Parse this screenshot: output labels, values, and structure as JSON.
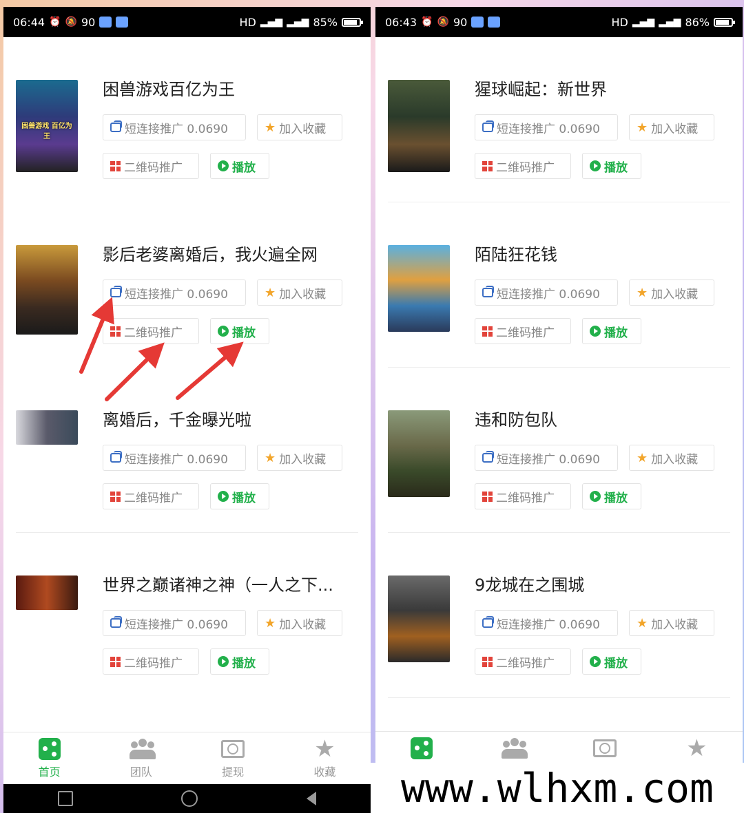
{
  "left_phone": {
    "status": {
      "time": "06:44",
      "net": "90",
      "right_text": "HD",
      "battery": "85%",
      "battery_level": 0.85
    },
    "items": [
      {
        "title": "困兽游戏百亿为王",
        "poster_text": "困兽游戏 百亿为王"
      },
      {
        "title": "影后老婆离婚后，我火遍全网",
        "poster_text": ""
      },
      {
        "title": "离婚后，千金曝光啦",
        "poster_text": ""
      },
      {
        "title": "世界之巅诸神之神（一人之下...",
        "poster_text": ""
      }
    ],
    "tabs": [
      {
        "label": "首页"
      },
      {
        "label": "团队"
      },
      {
        "label": "提现"
      },
      {
        "label": "收藏"
      }
    ]
  },
  "right_phone": {
    "status": {
      "time": "06:43",
      "net": "90",
      "right_text": "HD",
      "battery": "86%",
      "battery_level": 0.86
    },
    "items": [
      {
        "title": "猩球崛起：新世界",
        "poster_text": ""
      },
      {
        "title": "陌陆狂花钱",
        "poster_text": ""
      },
      {
        "title": "违和防包队",
        "poster_text": ""
      },
      {
        "title": "9龙城在之围城",
        "poster_text": ""
      }
    ]
  },
  "buttons": {
    "link": "短连接推广 0.0690",
    "fav": "加入收藏",
    "qr": "二维码推广",
    "play": "播放"
  },
  "watermark": "www.wlhxm.com",
  "colors": {
    "accent": "#22b04b",
    "star": "#f2a52b",
    "qr": "#e2443b",
    "arrow": "#e53935"
  }
}
